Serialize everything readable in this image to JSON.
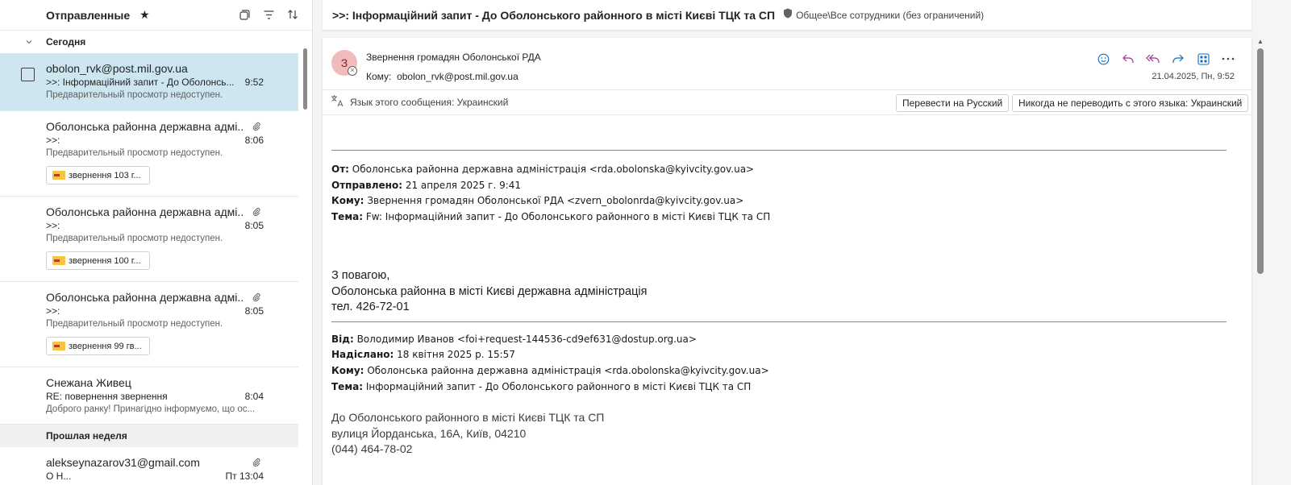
{
  "folder": {
    "title": "Отправленные"
  },
  "groups": {
    "today": "Сегодня",
    "last_week": "Прошлая неделя"
  },
  "messages": [
    {
      "sender": "obolon_rvk@post.mil.gov.ua",
      "subject": ">>: Інформаційний запит - До Оболонсь...",
      "time": "9:52",
      "preview": "Предварительный просмотр недоступен."
    },
    {
      "sender": "Оболонська районна державна адмі...",
      "subject": ">>:",
      "time": "8:06",
      "preview": "Предварительный просмотр недоступен.",
      "attachment": "звернення 103 г..."
    },
    {
      "sender": "Оболонська районна державна адмі...",
      "subject": ">>:",
      "time": "8:05",
      "preview": "Предварительный просмотр недоступен.",
      "attachment": "звернення 100 г..."
    },
    {
      "sender": "Оболонська районна державна адмі...",
      "subject": ">>:",
      "time": "8:05",
      "preview": "Предварительный просмотр недоступен.",
      "attachment": "звернення 99 гв..."
    },
    {
      "sender": "Снежана Живец",
      "subject": "RE: повернення звернення",
      "time": "8:04",
      "preview": "Доброго ранку! Принагідно інформуємо, що ос..."
    },
    {
      "sender": "alekseynazarov31@gmail.com",
      "subject": "О Н...",
      "time": "Пт 13:04",
      "preview": ""
    }
  ],
  "reading": {
    "subject": ">>: Інформаційний запит - До Оболонського районного в місті Києві ТЦК та СП",
    "sensitivity": "Общее\\Все сотрудники (без ограничений)",
    "avatar": "З",
    "from": "Звернення громадян Оболонської РДА",
    "to_label": "Кому:",
    "to": "obolon_rvk@post.mil.gov.ua",
    "date": "21.04.2025, Пн, 9:52",
    "lang_note": "Язык этого сообщения: Украинский",
    "translate_btn": "Перевести на Русский",
    "never_btn": "Никогда не переводить с этого языка: Украинский"
  },
  "fwd1": {
    "from_k": "От:",
    "from_v": "Оболонська районна державна адміністрація <rda.obolonska@kyivcity.gov.ua>",
    "sent_k": "Отправлено:",
    "sent_v": "21 апреля 2025 г. 9:41",
    "to_k": "Кому:",
    "to_v": "Звернення громадян Оболонської РДА <zvern_obolonrda@kyivcity.gov.ua>",
    "subj_k": "Тема:",
    "subj_v": "Fw: Інформаційний запит - До Оболонського районного в місті Києві ТЦК та СП"
  },
  "signature": {
    "line1": "З повагою,",
    "line2": "Оболонська районна в місті Києві державна адміністрація",
    "line3": "тел. 426-72-01"
  },
  "fwd2": {
    "from_k": "Від:",
    "from_v": "Володимир Иванов <foi+request-144536-cd9ef631@dostup.org.ua>",
    "sent_k": "Надіслано:",
    "sent_v": "18 квітня 2025 р. 15:57",
    "to_k": "Кому:",
    "to_v": "Оболонська районна державна адміністрація <rda.obolonska@kyivcity.gov.ua>",
    "subj_k": "Тема:",
    "subj_v": "Інформаційний запит - До Оболонського районного в місті Києві ТЦК та СП"
  },
  "address": {
    "line1": "До Оболонського районного в місті Києві ТЦК та СП",
    "line2": "вулиця Йорданська, 16А, Київ, 04210",
    "line3": "(044) 464-78-02"
  }
}
